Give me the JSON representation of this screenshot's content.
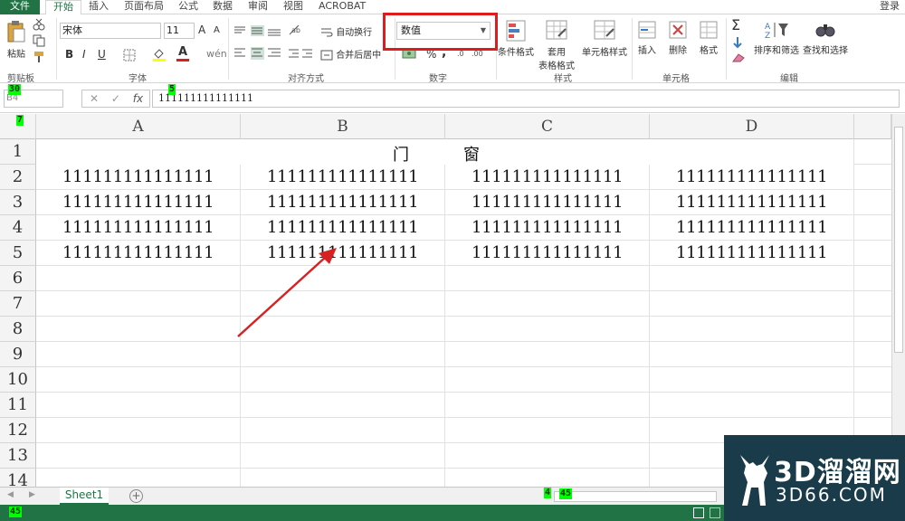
{
  "tabs": [
    "文件",
    "开始",
    "插入",
    "页面布局",
    "公式",
    "数据",
    "审阅",
    "视图",
    "ACROBAT"
  ],
  "login": "登录",
  "clipboard": {
    "paste": "粘贴",
    "group": "剪贴板"
  },
  "font": {
    "name": "宋体",
    "size": "11",
    "group": "字体",
    "bold": "B",
    "italic": "I",
    "underline": "U",
    "grow": "A",
    "shrink": "A",
    "color_letter": "A"
  },
  "alignment": {
    "wrap": "自动换行",
    "merge": "合并后居中",
    "group": "对齐方式"
  },
  "number": {
    "format": "数值",
    "group": "数字",
    "percent": "%",
    "comma": ","
  },
  "styles": {
    "conditional": "条件格式",
    "table_l1": "套用",
    "table_l2": "表格格式",
    "cell": "单元格样式",
    "group": "样式"
  },
  "cells": {
    "insert": "插入",
    "delete": "删除",
    "format": "格式",
    "group": "单元格"
  },
  "editing": {
    "sum": "Σ",
    "sort": "排序和筛选",
    "find": "查找和选择",
    "group": "编辑"
  },
  "formula_bar": {
    "name_box": "B4",
    "fx": "fx",
    "content": "111111111111111"
  },
  "columns": [
    "A",
    "B",
    "C",
    "D"
  ],
  "rows": [
    "1",
    "2",
    "3",
    "4",
    "5",
    "6",
    "7",
    "8",
    "9",
    "10",
    "11",
    "12",
    "13",
    "14"
  ],
  "title_row": "门窗",
  "cells_data": [
    [
      "111111111111111",
      "111111111111111",
      "111111111111111",
      "111111111111111"
    ],
    [
      "111111111111111",
      "111111111111111",
      "111111111111111",
      "111111111111111"
    ],
    [
      "111111111111111",
      "111111111111111",
      "111111111111111",
      "111111111111111"
    ],
    [
      "111111111111111",
      "111111111111111",
      "111111111111111",
      "111111111111111"
    ]
  ],
  "sheet": {
    "name": "Sheet1",
    "add": "+"
  },
  "overlay_marks": {
    "m1": "30",
    "m2": "5",
    "m3": "7",
    "m4": "4",
    "m5": "45",
    "m6": "45"
  },
  "watermark": {
    "main": "3D溜溜网",
    "sub": "3D66.COM"
  },
  "colors": {
    "excel_green": "#217346",
    "highlight_red": "#e01b1b",
    "arrow_red": "#d62222"
  }
}
